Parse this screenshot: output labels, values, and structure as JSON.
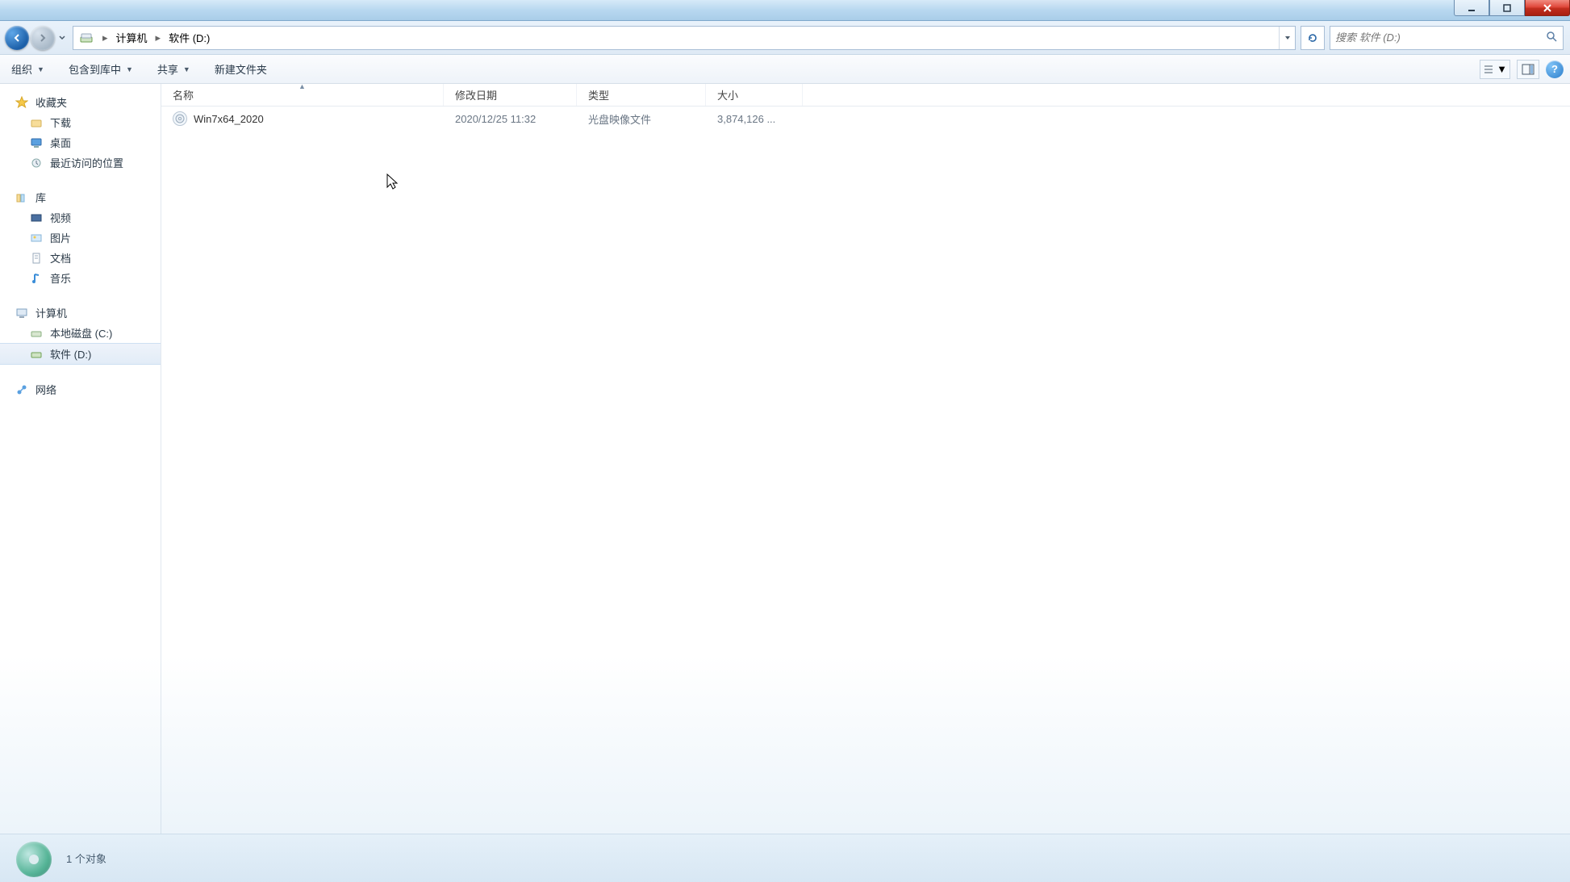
{
  "breadcrumb": {
    "seg1": "计算机",
    "seg2": "软件 (D:)",
    "sep": "▸"
  },
  "search": {
    "placeholder": "搜索 软件 (D:)"
  },
  "toolbar": {
    "organize": "组织",
    "include": "包含到库中",
    "share": "共享",
    "newfolder": "新建文件夹"
  },
  "columns": {
    "name": "名称",
    "date": "修改日期",
    "type": "类型",
    "size": "大小"
  },
  "files": [
    {
      "name": "Win7x64_2020",
      "date": "2020/12/25 11:32",
      "type": "光盘映像文件",
      "size": "3,874,126 ..."
    }
  ],
  "sidebar": {
    "favorites": "收藏夹",
    "downloads": "下载",
    "desktop": "桌面",
    "recent": "最近访问的位置",
    "libraries": "库",
    "videos": "视频",
    "pictures": "图片",
    "documents": "文档",
    "music": "音乐",
    "computer": "计算机",
    "localC": "本地磁盘 (C:)",
    "driveD": "软件 (D:)",
    "network": "网络"
  },
  "status": {
    "count": "1 个对象"
  }
}
